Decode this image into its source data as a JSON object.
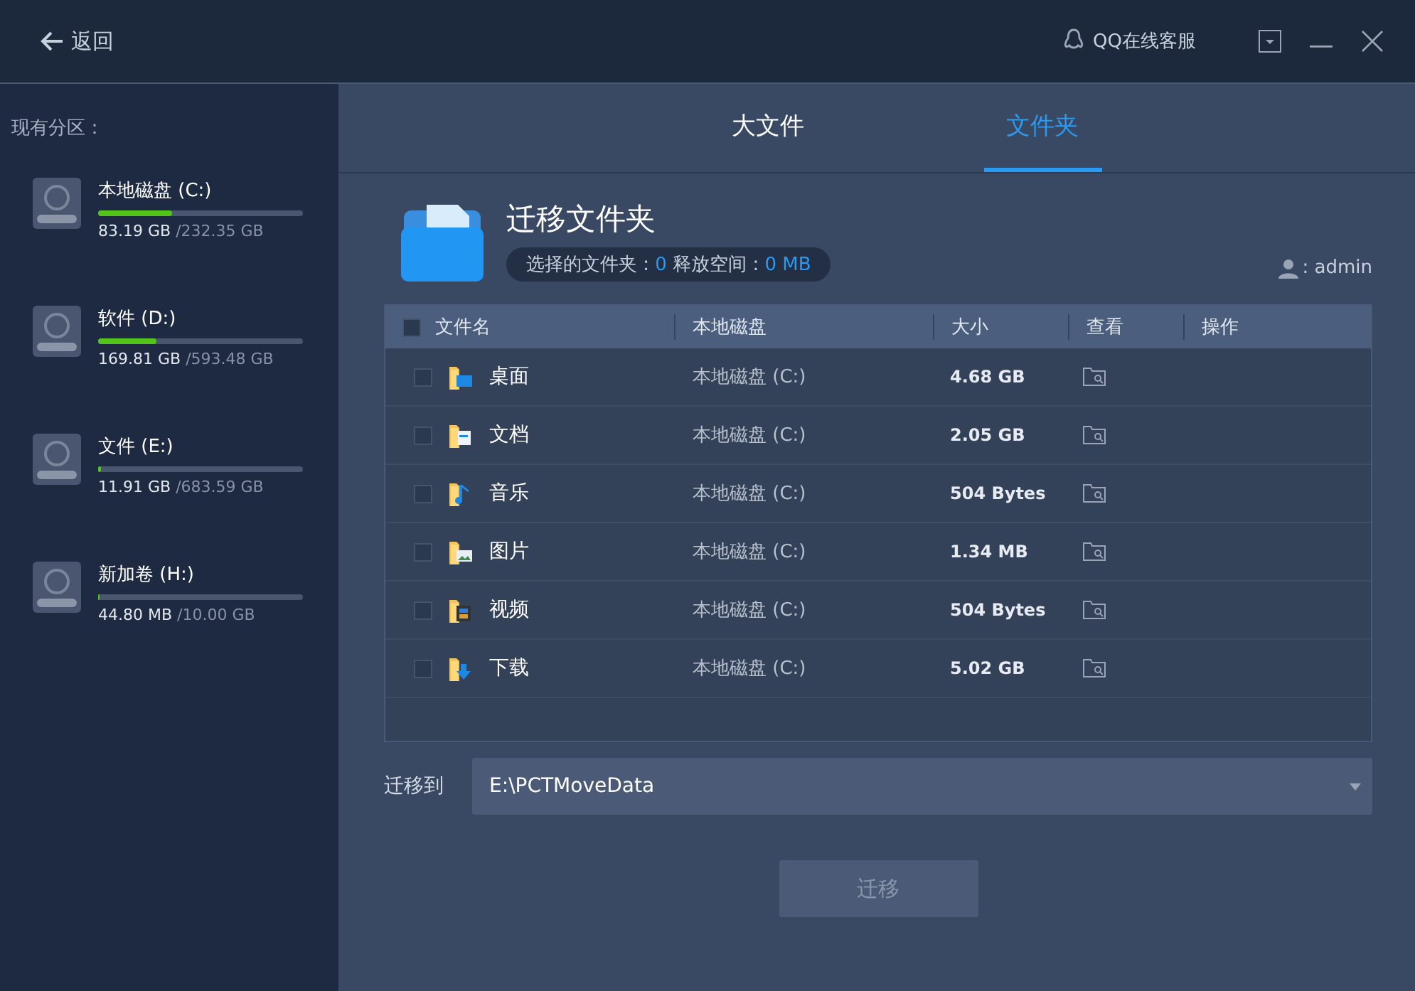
{
  "topbar": {
    "back": "返回",
    "support": "QQ在线客服"
  },
  "sidebar": {
    "title": "现有分区：",
    "drives": [
      {
        "name": "本地磁盘 (C:)",
        "used": "83.19 GB",
        "total": "/232.35 GB",
        "level": 0.358
      },
      {
        "name": "软件 (D:)",
        "used": "169.81 GB",
        "total": "/593.48 GB",
        "level": 0.286
      },
      {
        "name": "文件 (E:)",
        "used": "11.91 GB",
        "total": "/683.59 GB",
        "level": 0.017
      },
      {
        "name": "新加卷 (H:)",
        "used": "44.80 MB",
        "total": "/10.00 GB",
        "level": 0.004
      }
    ]
  },
  "tabs": [
    {
      "label": "大文件",
      "selected": false
    },
    {
      "label": "文件夹",
      "selected": true
    }
  ],
  "header": {
    "title": "迁移文件夹",
    "selected_label": "选择的文件夹 : ",
    "selected_count": "0",
    "space_label": " 释放空间 : ",
    "space_value": "0  MB",
    "user": ": admin"
  },
  "table": {
    "all_checked": false,
    "columns": [
      "文件名",
      "本地磁盘",
      "大小",
      "查看",
      "操作"
    ],
    "rows": [
      {
        "name": "桌面",
        "disk": "本地磁盘 (C:)",
        "size": "4.68 GB",
        "checked": false,
        "kind": "desktop"
      },
      {
        "name": "文档",
        "disk": "本地磁盘 (C:)",
        "size": "2.05 GB",
        "checked": false,
        "kind": "documents"
      },
      {
        "name": "音乐",
        "disk": "本地磁盘 (C:)",
        "size": "504 Bytes",
        "checked": false,
        "kind": "music"
      },
      {
        "name": "图片",
        "disk": "本地磁盘 (C:)",
        "size": "1.34 MB",
        "checked": false,
        "kind": "pictures"
      },
      {
        "name": "视频",
        "disk": "本地磁盘 (C:)",
        "size": "504 Bytes",
        "checked": false,
        "kind": "videos"
      },
      {
        "name": "下载",
        "disk": "本地磁盘 (C:)",
        "size": "5.02 GB",
        "checked": false,
        "kind": "downloads"
      }
    ]
  },
  "target": {
    "label": "迁移到",
    "value": "E:\\PCTMoveData"
  },
  "action": {
    "label": "迁移",
    "disabled": true
  }
}
